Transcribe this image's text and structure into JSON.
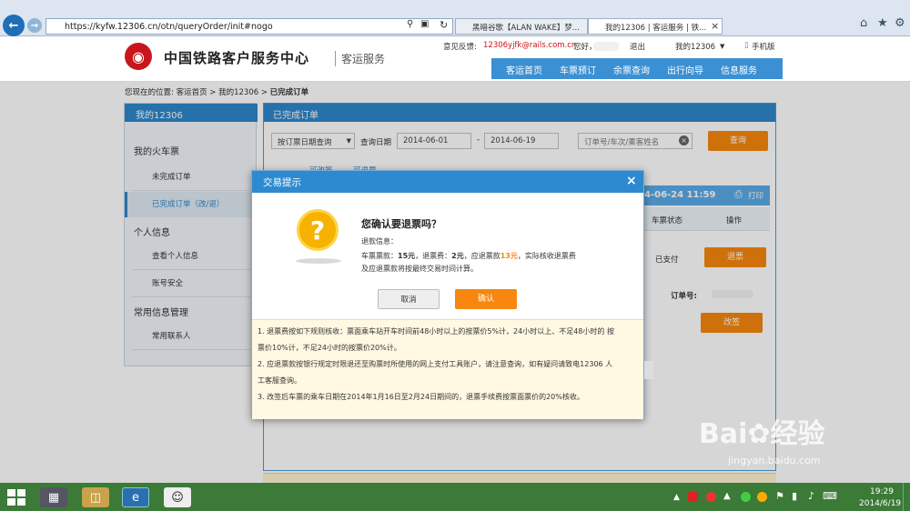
{
  "browser": {
    "url": "https://kyfw.12306.cn/otn/queryOrder/init#nogo",
    "tab1": "黑暗谷歌【ALAN WAKE】梦...",
    "tab2": "我的12306 | 客运服务 | 铁...",
    "tab_close": "×"
  },
  "header": {
    "logo_title": "中国铁路客户服务中心",
    "logo_sub": "客运服务",
    "feedback_label": "意见反馈:",
    "feedback_email": "12306yjfk@rails.com.cn",
    "greeting": "您好，",
    "logout": "退出",
    "my12306": "我的12306",
    "mobile": "手机版",
    "nav": [
      "客运首页",
      "车票预订",
      "余票查询",
      "出行向导",
      "信息服务"
    ]
  },
  "breadcrumb": {
    "prefix": "您现在的位置: 客运首页 > 我的12306 >",
    "current": "已完成订单"
  },
  "sidebar": {
    "title": "我的12306",
    "groups": [
      "我的火车票",
      "个人信息",
      "常用信息管理"
    ],
    "items": [
      "未完成订单",
      "已完成订单（改/退）",
      "查看个人信息",
      "账号安全",
      "常用联系人"
    ]
  },
  "content": {
    "title": "已完成订单",
    "filter_select": "按订票日期查询",
    "date_label": "查询日期",
    "date_from": "2014-06-01",
    "date_sep": "-",
    "date_to": "2014-06-19",
    "search_placeholder": "订单号/车次/乘客姓名",
    "query_btn": "查询",
    "subtabs": [
      "可改签",
      "可退票"
    ],
    "order_date": "4-06-24 11:59",
    "print": "打印",
    "col_status": "车票状态",
    "col_action": "操作",
    "status_val": "已支付",
    "refund_btn": "退票",
    "order_no_label": "订单号:",
    "change_btn": "改签"
  },
  "dialog": {
    "title": "交易提示",
    "close": "×",
    "question": "您确认要退票吗？",
    "info_label": "退款信息：",
    "fare_label": "车票票款：",
    "fare_val": "15元",
    "fee_label": "，退票费：",
    "fee_val": "2元",
    "refund_label": "，应退票款",
    "refund_val": "13元",
    "fare_tail": "，实际核收退票费",
    "fare_line2": "及应退票款将按最终交易时间计算。",
    "cancel": "取消",
    "confirm": "确认",
    "notes": [
      "1. 退票费按如下规则核收：票面乘车站开车时间前48小时以上的按票价5%计，24小时以上、不足48小时的 按",
      "票价10%计，不足24小时的按票价20%计。",
      "2. 应退票款按银行规定时限退还至购票时所使用的网上支付工具账户，请注意查询，如有疑问请致电12306 人",
      "工客服查询。",
      "3. 改签后车票的乘车日期在2014年1月16日至2月24日期间的，退票手续费按票面票价的20%核收。"
    ]
  },
  "taskbar": {
    "time": "19:29",
    "date": "2014/6/19"
  },
  "watermark": {
    "brand": "Bai",
    "cn": "经验",
    "url": "jingyan.baidu.com"
  }
}
